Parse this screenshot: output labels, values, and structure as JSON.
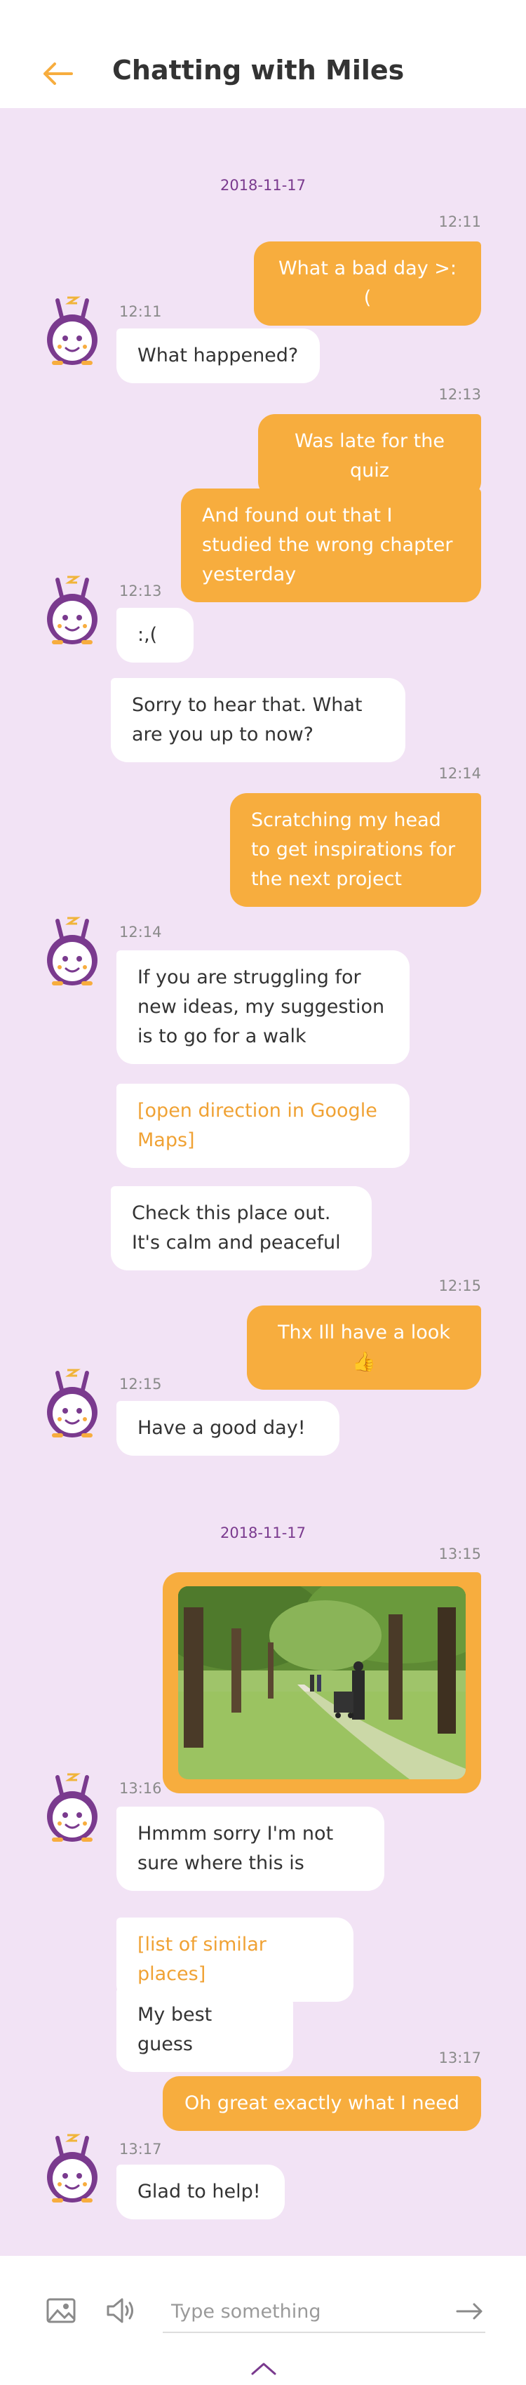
{
  "header": {
    "title": "Chatting with Miles"
  },
  "dates": [
    "2018-11-17",
    "2018-11-17"
  ],
  "times": [
    "12:11",
    "12:11",
    "12:13",
    "12:13",
    "12:14",
    "12:14",
    "12:15",
    "12:15",
    "13:15",
    "13:16",
    "13:17",
    "13:17"
  ],
  "messages": [
    {
      "text": "What a bad day >:("
    },
    {
      "text": "What happened?"
    },
    {
      "text": "Was late for the quiz"
    },
    {
      "text": "And found out that I studied the wrong chapter yesterday"
    },
    {
      "text": ":,("
    },
    {
      "text": "Sorry to hear that. What are you up to now?"
    },
    {
      "text": "Scratching my head to get inspirations for the next project"
    },
    {
      "text": "If you are struggling for new ideas, my suggestion is to go for a walk"
    },
    {
      "text": "[open direction in Google Maps]"
    },
    {
      "text": "Check this place out. It's calm and peaceful"
    },
    {
      "text": "Thx Ill have a look 👍"
    },
    {
      "text": "Have a good day!"
    },
    {
      "text": "Hmmm sorry I'm not sure where this is"
    },
    {
      "text": "[list of similar places]"
    },
    {
      "text": "My best guess"
    },
    {
      "text": "Oh great exactly what I need"
    },
    {
      "text": "Glad to help!"
    }
  ],
  "composer": {
    "placeholder": "Type something"
  },
  "icons": {
    "back": "arrow-left-icon",
    "image": "image-icon",
    "speaker": "speaker-icon",
    "send": "arrow-right-icon",
    "expand": "chevron-up-icon",
    "avatar": "bunny-robot-avatar"
  },
  "colors": {
    "accent": "#f7ad3e",
    "background": "#f2e3f5",
    "avatar": "#7a3a8e",
    "date": "#7a3a8e"
  }
}
